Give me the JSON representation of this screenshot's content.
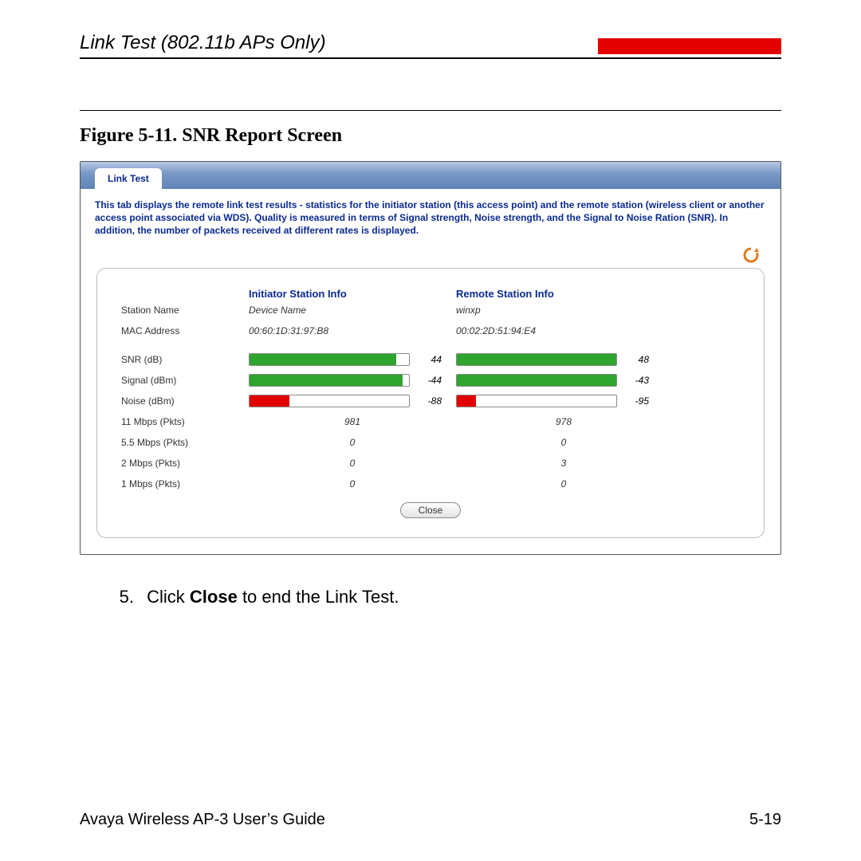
{
  "header": {
    "section_title": "Link Test (802.11b APs Only)"
  },
  "figure": {
    "label": "Figure 5-11.    SNR Report Screen"
  },
  "screenshot": {
    "tab_label": "Link Test",
    "description": "This tab displays the remote link test results - statistics for the initiator station (this access point) and the remote station (wireless client or another access point associated via WDS). Quality is measured in terms of Signal strength, Noise strength, and the Signal to Noise Ration (SNR). In addition, the number of packets received at different rates is displayed.",
    "col_initiator": "Initiator Station Info",
    "col_remote": "Remote Station Info",
    "rows": {
      "station_name": {
        "label": "Station Name",
        "initiator": "Device Name",
        "remote": "winxp"
      },
      "mac": {
        "label": "MAC Address",
        "initiator": "00:60:1D:31:97:B8",
        "remote": "00:02:2D:51:94:E4"
      },
      "snr": {
        "label": "SNR (dB)",
        "initiator_val": "44",
        "initiator_pct": 92,
        "initiator_color": "green",
        "remote_val": "48",
        "remote_pct": 100,
        "remote_color": "green"
      },
      "signal": {
        "label": "Signal (dBm)",
        "initiator_val": "-44",
        "initiator_pct": 96,
        "initiator_color": "green",
        "remote_val": "-43",
        "remote_pct": 100,
        "remote_color": "green"
      },
      "noise": {
        "label": "Noise (dBm)",
        "initiator_val": "-88",
        "initiator_pct": 25,
        "initiator_color": "red",
        "remote_val": "-95",
        "remote_pct": 12,
        "remote_color": "red"
      },
      "r11": {
        "label": "11 Mbps (Pkts)",
        "initiator": "981",
        "remote": "978"
      },
      "r55": {
        "label": "5.5 Mbps (Pkts)",
        "initiator": "0",
        "remote": "0"
      },
      "r2": {
        "label": "2 Mbps (Pkts)",
        "initiator": "0",
        "remote": "3"
      },
      "r1": {
        "label": "1 Mbps (Pkts)",
        "initiator": "0",
        "remote": "0"
      }
    },
    "close_label": "Close"
  },
  "step": {
    "number": "5.",
    "prefix": "Click ",
    "bold": "Close",
    "suffix": " to end the Link Test."
  },
  "footer": {
    "guide": "Avaya Wireless AP-3 User’s Guide",
    "page": "5-19"
  }
}
